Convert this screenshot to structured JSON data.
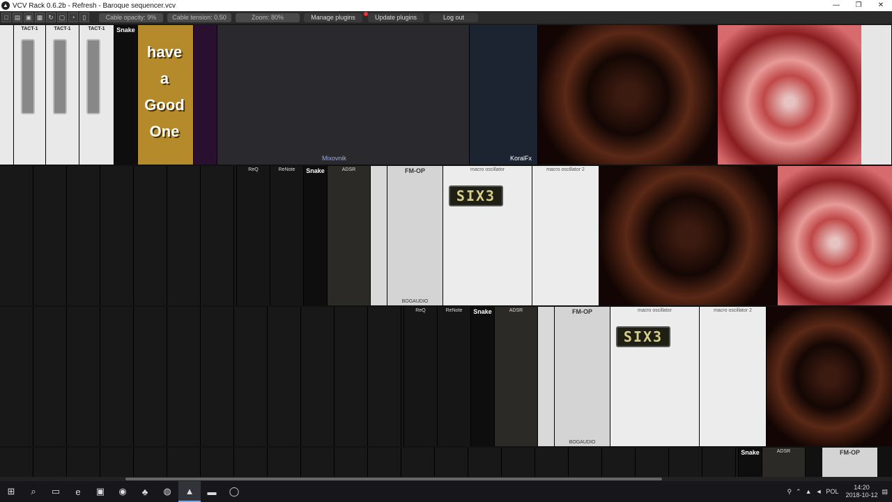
{
  "window": {
    "title": "VCV Rack 0.6.2b - Refresh - Baroque sequencer.vcv",
    "minimize": "—",
    "maximize": "❐",
    "close": "✕"
  },
  "toolbar": {
    "icons": [
      "new-icon",
      "open-icon",
      "save-icon",
      "save-as-icon",
      "revert-icon",
      "clear-icon",
      "power-meter-icon",
      "lock-icon"
    ],
    "cable_opacity": "Cable opacity: 9%",
    "cable_tension": "Cable tension: 0.50",
    "zoom": "Zoom: 80%",
    "manage_plugins": "Manage plugins",
    "update_plugins": "Update plugins",
    "log_out": "Log out"
  },
  "modules": {
    "tact": "TACT-1",
    "restep": "ReStep",
    "snake": "Snake",
    "adsr": "ADSR",
    "fm_op": "FM-OP",
    "req": "ReQ",
    "renote": "ReNote",
    "macro1": "macro oscillator",
    "macro2": "macro oscillator 2",
    "six3": "SIX3",
    "mixovnik": "Mixovnik",
    "koralfx": "KoralFx",
    "have": "have",
    "a": "a",
    "good": "Good",
    "one": "One",
    "bogaudio": "BOGAUDIO"
  },
  "taskbar": {
    "time": "14:20",
    "date": "2018-10-12",
    "lang": "POL"
  },
  "colors": {
    "toolbar_bg": "#2b2b2b",
    "rack_bg": "#111111",
    "taskbar_bg": "#17171b",
    "accent_red": "#e33333"
  }
}
